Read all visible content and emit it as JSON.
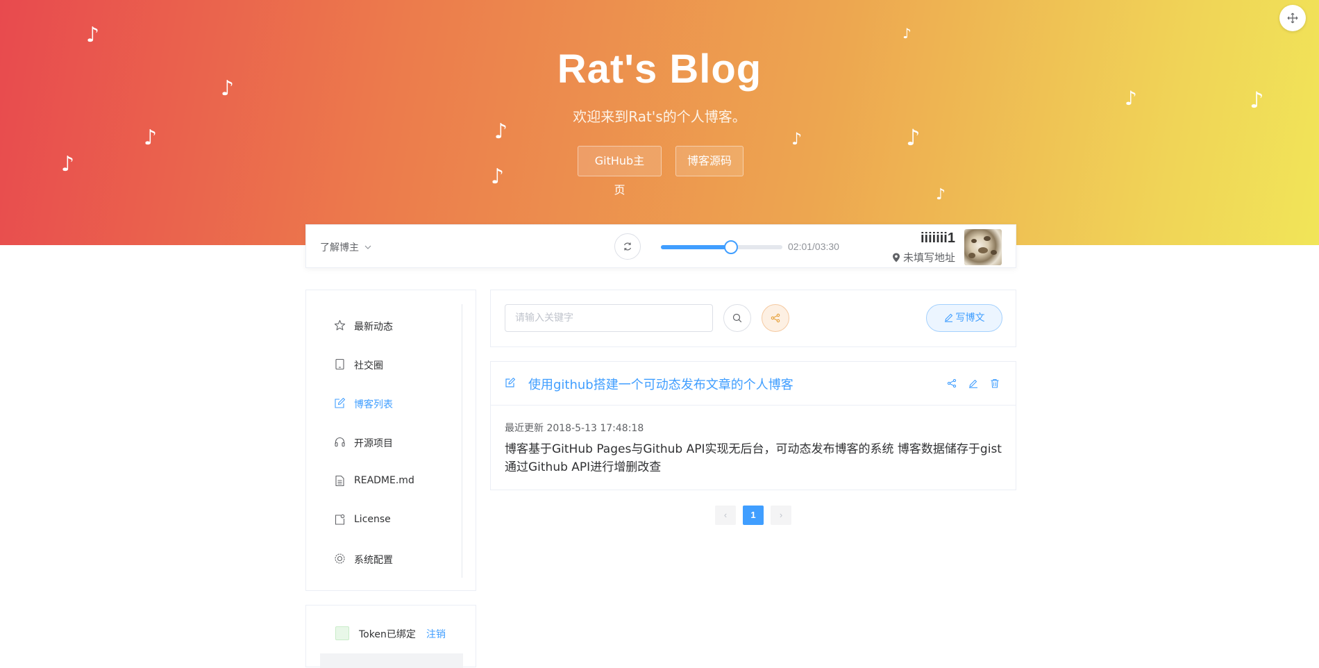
{
  "hero": {
    "title": "Rat's Blog",
    "subtitle": "欢迎来到Rat's的个人博客。",
    "buttons": [
      "GitHub主页",
      "博客源码"
    ],
    "note_glyph": "♪"
  },
  "topbar": {
    "about_label": "了解博主",
    "player": {
      "time": "02:01/03:30",
      "progress": 0.576
    },
    "user": {
      "name": "iiiiiii1",
      "address": "未填写地址"
    }
  },
  "sidebar": {
    "items": [
      {
        "label": "最新动态",
        "icon": "star-icon",
        "active": false
      },
      {
        "label": "社交圈",
        "icon": "tablet-icon",
        "active": false
      },
      {
        "label": "博客列表",
        "icon": "edit-icon",
        "active": true
      },
      {
        "label": "开源项目",
        "icon": "headset-icon",
        "active": false
      },
      {
        "label": "README.md",
        "icon": "document-icon",
        "active": false
      },
      {
        "label": "License",
        "icon": "license-icon",
        "active": false
      },
      {
        "label": "系统配置",
        "icon": "gear-icon",
        "active": false
      }
    ],
    "token": {
      "label": "Token已绑定",
      "action": "注销"
    }
  },
  "search": {
    "placeholder": "请输入关键字",
    "write_label": "写博文"
  },
  "post": {
    "title": "使用github搭建一个可动态发布文章的个人博客",
    "updated": "最近更新 2018-5-13 17:48:18",
    "body": "博客基于GitHub Pages与Github API实现无后台，可动态发布博客的系统 博客数据储存于gist通过Github API进行增删改查"
  },
  "pagination": {
    "current": "1",
    "prev": "‹",
    "next": "›"
  },
  "colors": {
    "accent": "#409eff",
    "gradient_start": "#e84a4e",
    "gradient_end": "#f1e558",
    "share_accent": "#f0a35a"
  }
}
